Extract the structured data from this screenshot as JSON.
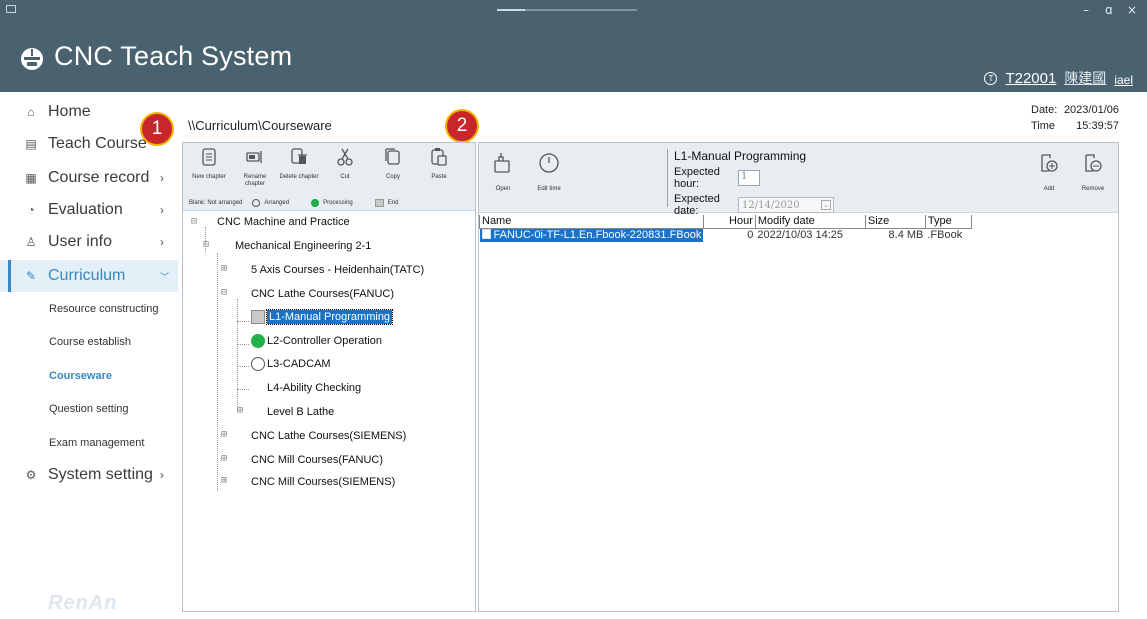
{
  "header": {
    "title": "CNC Teach System",
    "user_id": "T22001",
    "user_name": "陳建國",
    "user_tail": "iael"
  },
  "window": {
    "min": "–",
    "max": "ɑ",
    "close": "×"
  },
  "sidebar": {
    "items": [
      {
        "label": "Home",
        "icon": "home-icon"
      },
      {
        "label": "Teach Course",
        "icon": "monitor-icon"
      },
      {
        "label": "Course record",
        "icon": "document-icon"
      },
      {
        "label": "Evaluation",
        "icon": "chart-icon"
      },
      {
        "label": "User info",
        "icon": "user-icon"
      },
      {
        "label": "Curriculum",
        "icon": "pencil-icon"
      },
      {
        "label": "System setting",
        "icon": "gear-icon"
      }
    ],
    "chevron": "›",
    "chevron_down": "﹀",
    "subitems": [
      "Resource constructing",
      "Course establish",
      "Courseware",
      "Question setting",
      "Exam management"
    ],
    "brand": "RenAn"
  },
  "main": {
    "path": "\\\\Curriculum\\Courseware",
    "date_label": "Date:",
    "date_value": "2023/01/06",
    "time_label": "Time",
    "time_value": "15:39:57",
    "badges": [
      "1",
      "2"
    ]
  },
  "toolbar": {
    "buttons": [
      {
        "label": "New chapter",
        "icon": "new-chapter-icon"
      },
      {
        "label": "Rename chapter",
        "icon": "rename-icon"
      },
      {
        "label": "Delete chapter",
        "icon": "delete-icon"
      },
      {
        "label": "Cut",
        "icon": "scissors-icon"
      },
      {
        "label": "Copy",
        "icon": "copy-icon"
      },
      {
        "label": "Paste",
        "icon": "paste-icon"
      }
    ],
    "legend": {
      "blank": "Blank: Not arranged",
      "arranged": "Arranged",
      "processing": "Processing",
      "end": "End"
    }
  },
  "tree": {
    "root": "CNC Machine and Practice",
    "level1": "Mechanical Engineering 2-1",
    "courses": [
      "5 Axis Courses - Heidenhain(TATC)",
      "CNC Lathe Courses(FANUC)",
      "CNC Lathe Courses(SIEMENS)",
      "CNC Mill Courses(FANUC)",
      "CNC Mill Courses(SIEMENS)"
    ],
    "lessons": [
      "L1-Manual Programming",
      "L2-Controller Operation",
      "L3-CADCAM",
      "L4-Ability Checking",
      "Level B Lathe"
    ],
    "expand": "⊞",
    "collapse": "⊟"
  },
  "right": {
    "buttons": [
      {
        "label": "Open",
        "icon": "open-icon"
      },
      {
        "label": "Edit time",
        "icon": "clock-icon"
      },
      {
        "label": "Add",
        "icon": "add-icon"
      },
      {
        "label": "Remove",
        "icon": "remove-icon"
      }
    ],
    "info_title": "L1-Manual Programming",
    "expected_hour_label": "Expected hour:",
    "expected_hour_value": "1",
    "expected_date_label": "Expected date:",
    "expected_date_value": "12/14/2020",
    "dropdown": "⌄",
    "columns": [
      "Name",
      "Hour",
      "Modify date",
      "Size",
      "Type"
    ],
    "rows": [
      {
        "name": "FANUC-0i-TF-L1.En.Fbook-220831.FBook",
        "hour": "0",
        "modify_date": "2022/10/03 14:25",
        "size": "8.4 MB",
        "type": ".FBook"
      }
    ]
  }
}
